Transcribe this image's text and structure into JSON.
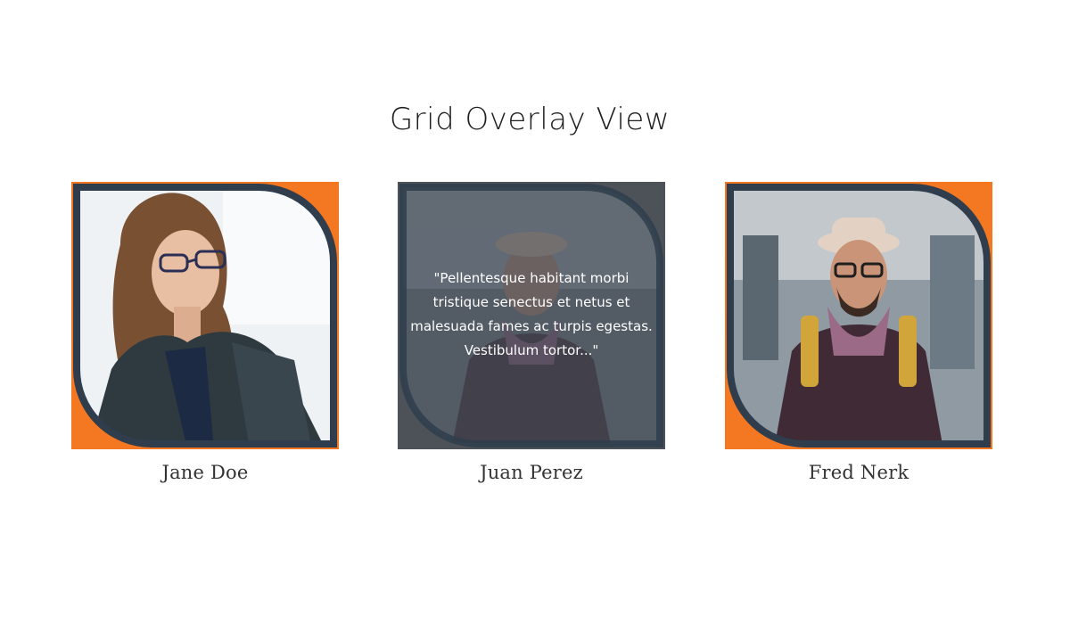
{
  "header": {
    "title": "Grid Overlay View"
  },
  "theme": {
    "accent": "#f47721",
    "frame": "#2f3d4c",
    "overlay": "#5e4538"
  },
  "team": [
    {
      "name": "Jane Doe"
    },
    {
      "name": "Juan Perez",
      "quote": "\"Pellentesque habitant morbi tristique senectus et netus et malesuada fames ac turpis egestas. Vestibulum tortor...\""
    },
    {
      "name": "Fred Nerk"
    }
  ]
}
